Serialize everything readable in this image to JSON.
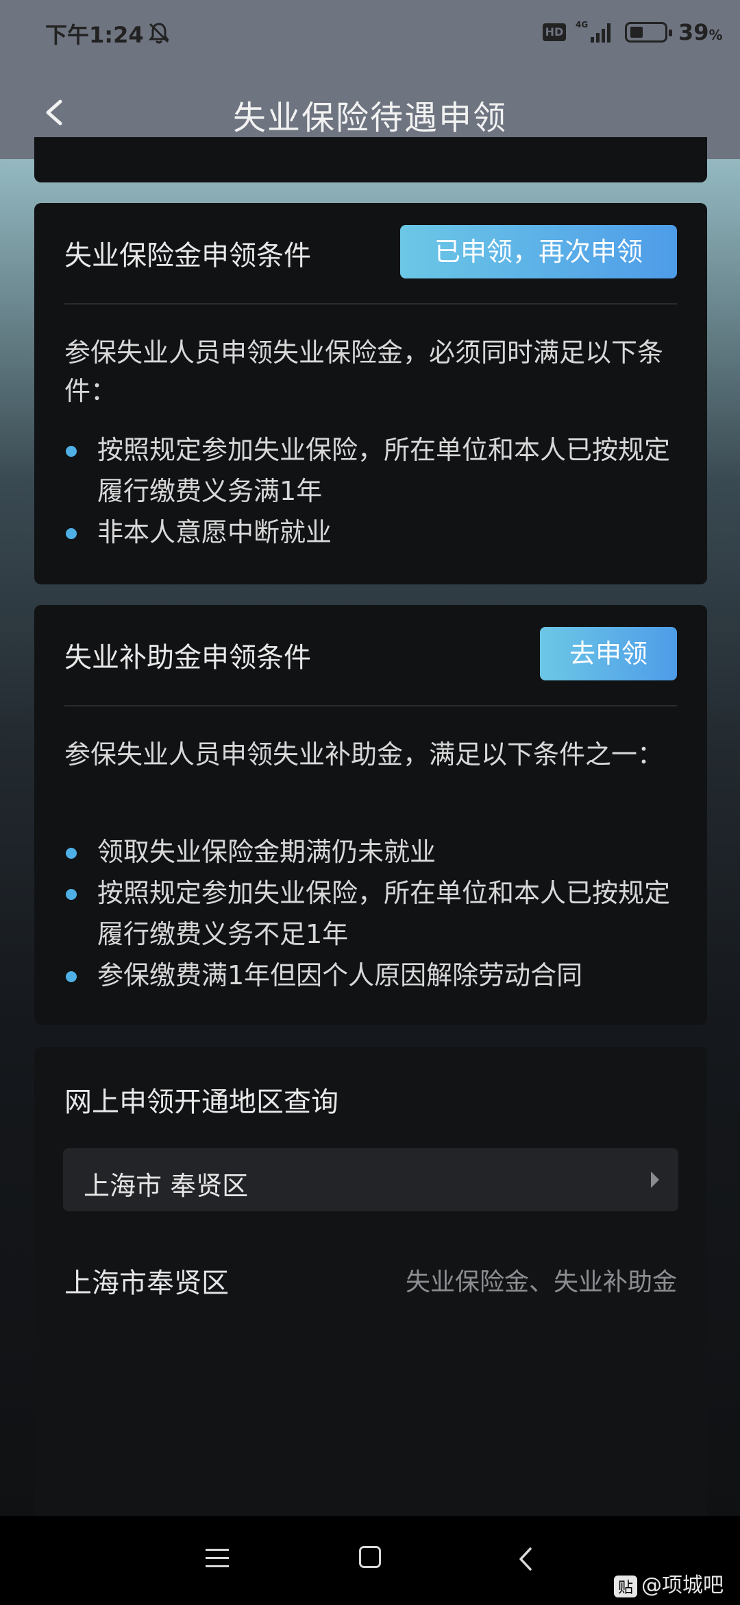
{
  "status_bar": {
    "time": "下午1:24",
    "network": "4G",
    "hd_label": "HD",
    "battery_percent": "39",
    "battery_unit": "%"
  },
  "header": {
    "title": "失业保险待遇申领",
    "back_icon": "chevron-left-icon"
  },
  "unemployment_insurance": {
    "title": "失业保险金申领条件",
    "button_label": "已申领，再次申领",
    "intro": "参保失业人员申领失业保险金，必须同时满足以下条件：",
    "conditions": [
      "按照规定参加失业保险，所在单位和本人已按规定履行缴费义务满1年",
      "非本人意愿中断就业"
    ]
  },
  "unemployment_subsidy": {
    "title": "失业补助金申领条件",
    "button_label": "去申领",
    "intro": "参保失业人员申领失业补助金，满足以下条件之一：",
    "conditions": [
      "领取失业保险金期满仍未就业",
      "按照规定参加失业保险，所在单位和本人已按规定履行缴费义务不足1年",
      "参保缴费满1年但因个人原因解除劳动合同"
    ]
  },
  "region_query": {
    "title": "网上申领开通地区查询",
    "selected_region": "上海市 奉贤区",
    "result_region": "上海市奉贤区",
    "result_services": "失业保险金、失业补助金"
  },
  "nav_bar": {
    "icons": [
      "menu-icon",
      "home-icon",
      "back-icon"
    ]
  },
  "watermark": {
    "badge": "贴",
    "text": "@项城吧"
  },
  "colors": {
    "accent_start": "#6cc7e6",
    "accent_end": "#4e9ce8",
    "bullet": "#4fb0e6",
    "header_bg": "#6e7480"
  }
}
